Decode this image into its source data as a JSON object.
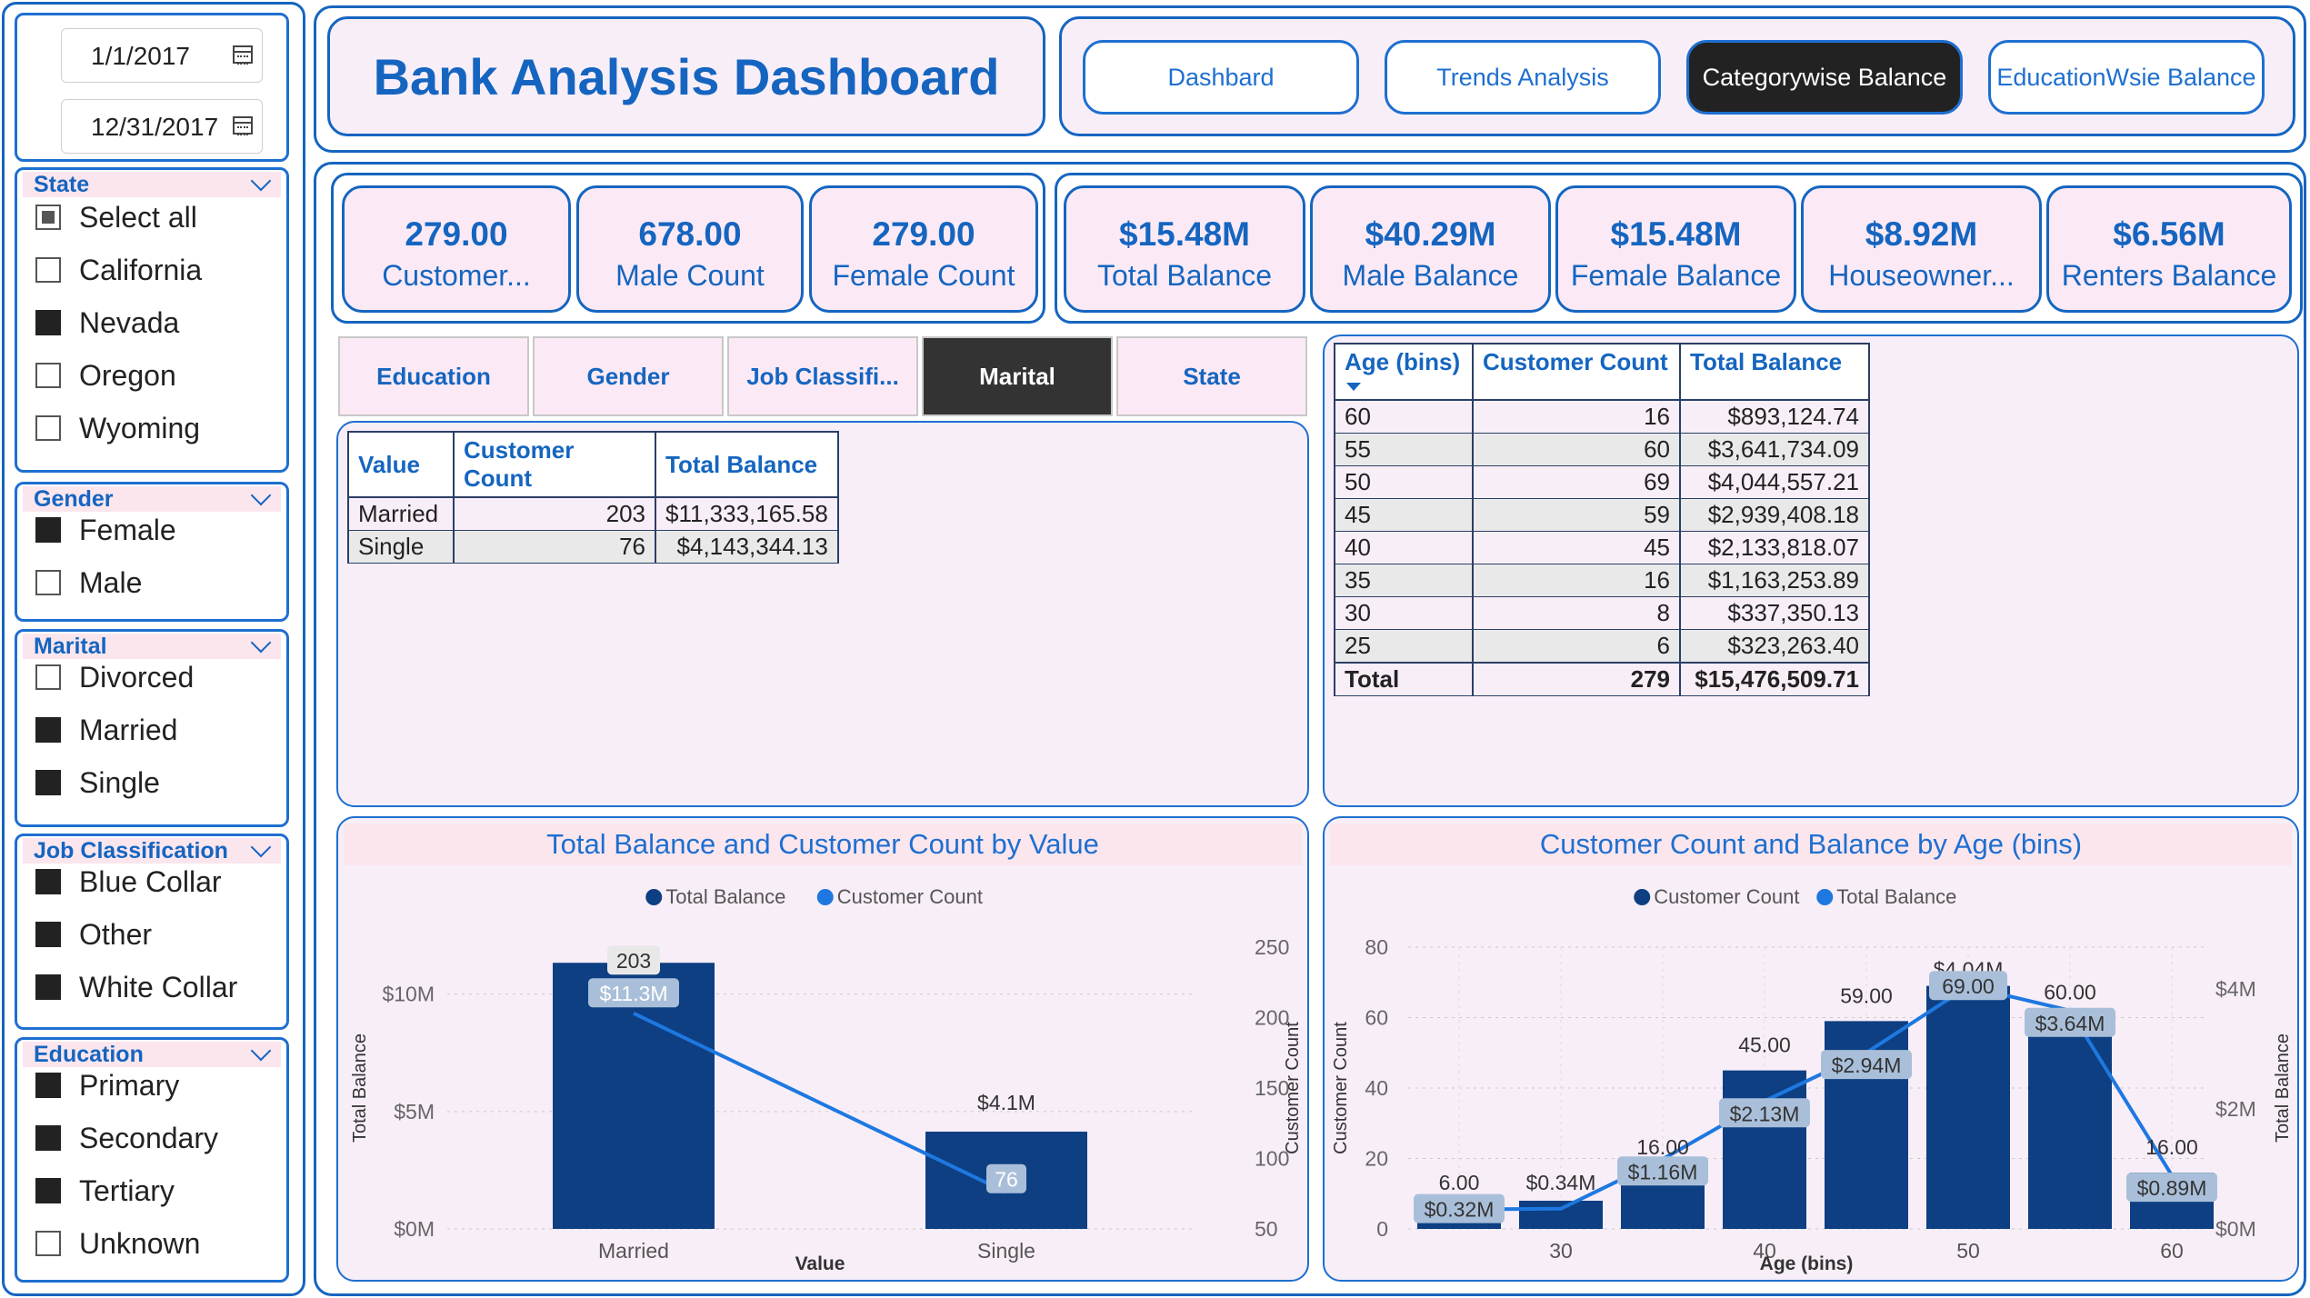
{
  "dates": {
    "start": "1/1/2017",
    "end": "12/31/2017"
  },
  "header": {
    "title": "Bank Analysis Dashboard"
  },
  "nav": [
    {
      "label": "Dashbard",
      "active": false
    },
    {
      "label": "Trends Analysis",
      "active": false
    },
    {
      "label": "Categorywise Balance",
      "active": true
    },
    {
      "label": "EducationWsie Balance",
      "active": false
    }
  ],
  "slicers": {
    "state": {
      "title": "State",
      "items": [
        {
          "label": "Select all",
          "state": "partial"
        },
        {
          "label": "California",
          "state": "off"
        },
        {
          "label": "Nevada",
          "state": "on"
        },
        {
          "label": "Oregon",
          "state": "off"
        },
        {
          "label": "Wyoming",
          "state": "off"
        }
      ]
    },
    "gender": {
      "title": "Gender",
      "items": [
        {
          "label": "Female",
          "state": "on"
        },
        {
          "label": "Male",
          "state": "off"
        }
      ]
    },
    "marital": {
      "title": "Marital",
      "items": [
        {
          "label": "Divorced",
          "state": "off"
        },
        {
          "label": "Married",
          "state": "on"
        },
        {
          "label": "Single",
          "state": "on"
        }
      ]
    },
    "job": {
      "title": "Job Classification",
      "items": [
        {
          "label": "Blue Collar",
          "state": "on"
        },
        {
          "label": "Other",
          "state": "on"
        },
        {
          "label": "White Collar",
          "state": "on"
        }
      ]
    },
    "education": {
      "title": "Education",
      "items": [
        {
          "label": "Primary",
          "state": "on"
        },
        {
          "label": "Secondary",
          "state": "on"
        },
        {
          "label": "Tertiary",
          "state": "on"
        },
        {
          "label": "Unknown",
          "state": "off"
        }
      ]
    }
  },
  "kpis": [
    {
      "value": "279.00",
      "label": "Customer..."
    },
    {
      "value": "678.00",
      "label": "Male Count"
    },
    {
      "value": "279.00",
      "label": "Female Count"
    },
    {
      "value": "$15.48M",
      "label": "Total Balance"
    },
    {
      "value": "$40.29M",
      "label": "Male Balance"
    },
    {
      "value": "$15.48M",
      "label": "Female Balance"
    },
    {
      "value": "$8.92M",
      "label": "Houseowner..."
    },
    {
      "value": "$6.56M",
      "label": "Renters Balance"
    }
  ],
  "tabs": [
    {
      "label": "Education",
      "active": false
    },
    {
      "label": "Gender",
      "active": false
    },
    {
      "label": "Job Classifi...",
      "active": false
    },
    {
      "label": "Marital",
      "active": true
    },
    {
      "label": "State",
      "active": false
    }
  ],
  "value_table": {
    "headers": [
      "Value",
      "Customer Count",
      "Total Balance"
    ],
    "rows": [
      [
        "Married",
        "203",
        "$11,333,165.58"
      ],
      [
        "Single",
        "76",
        "$4,143,344.13"
      ]
    ]
  },
  "age_table": {
    "headers": [
      "Age (bins)",
      "Customer Count",
      "Total Balance"
    ],
    "rows": [
      [
        "60",
        "16",
        "$893,124.74"
      ],
      [
        "55",
        "60",
        "$3,641,734.09"
      ],
      [
        "50",
        "69",
        "$4,044,557.21"
      ],
      [
        "45",
        "59",
        "$2,939,408.18"
      ],
      [
        "40",
        "45",
        "$2,133,818.07"
      ],
      [
        "35",
        "16",
        "$1,163,253.89"
      ],
      [
        "30",
        "8",
        "$337,350.13"
      ],
      [
        "25",
        "6",
        "$323,263.40"
      ]
    ],
    "total": [
      "Total",
      "279",
      "$15,476,509.71"
    ]
  },
  "chart_data": [
    {
      "type": "bar",
      "title": "Total Balance and Customer Count by Value",
      "xlabel": "Value",
      "ylabel": "Total Balance",
      "y2label": "Customer Count",
      "categories": [
        "Married",
        "Single"
      ],
      "series": [
        {
          "name": "Total Balance",
          "type": "bar",
          "values": [
            11333165.58,
            4143344.13
          ],
          "labels": [
            "$11.3M",
            "$4.1M"
          ]
        },
        {
          "name": "Customer Count",
          "type": "line",
          "values": [
            203,
            76
          ],
          "labels": [
            "203",
            "76"
          ]
        }
      ],
      "ylim": [
        0,
        12000000
      ],
      "y2lim": [
        50,
        250
      ],
      "yticks": [
        "$0M",
        "$5M",
        "$10M"
      ],
      "y2ticks": [
        "50",
        "100",
        "150",
        "200",
        "250"
      ],
      "legend": "top-center",
      "colors": {
        "bar": "#0d3f82",
        "line": "#1e78e0"
      }
    },
    {
      "type": "bar",
      "title": "Customer Count and Balance by Age (bins)",
      "xlabel": "Age (bins)",
      "ylabel": "Customer Count",
      "y2label": "Total Balance",
      "categories": [
        25,
        30,
        35,
        40,
        45,
        50,
        55,
        60
      ],
      "xticks": [
        "30",
        "40",
        "50",
        "60"
      ],
      "series": [
        {
          "name": "Customer Count",
          "type": "bar",
          "values": [
            6,
            8,
            16,
            45,
            59,
            69,
            60,
            16
          ],
          "labels": [
            "6.00",
            "",
            "16.00",
            "45.00",
            "59.00",
            "69.00",
            "60.00",
            "16.00"
          ]
        },
        {
          "name": "Total Balance",
          "type": "line",
          "values": [
            323263.4,
            337350.13,
            1163253.89,
            2133818.07,
            2939408.18,
            4044557.21,
            3641734.09,
            893124.74
          ],
          "labels": [
            "$0.32M",
            "$0.34M",
            "$1.16M",
            "$2.13M",
            "$2.94M",
            "$4.04M",
            "$3.64M",
            "$0.89M"
          ]
        }
      ],
      "ylim": [
        0,
        80
      ],
      "y2lim": [
        0,
        4700000
      ],
      "yticks": [
        "0",
        "20",
        "40",
        "60",
        "80"
      ],
      "y2ticks": [
        "$0M",
        "$2M",
        "$4M"
      ],
      "legend": "top-center",
      "colors": {
        "bar": "#0d3f82",
        "line": "#1e78e0"
      }
    }
  ]
}
